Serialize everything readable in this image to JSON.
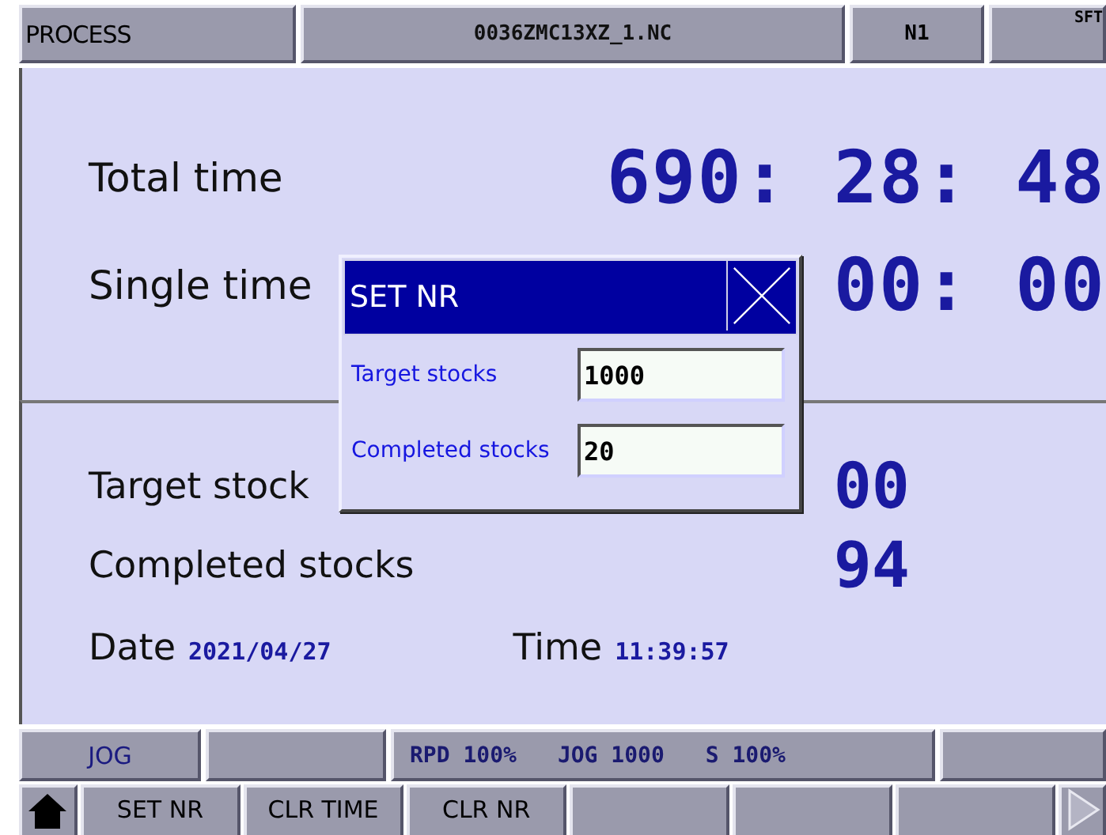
{
  "header": {
    "mode": "PROCESS",
    "program": "0036ZMC13XZ_1.NC",
    "sequence": "N1",
    "shift": "SFT"
  },
  "times": [
    {
      "label": "Total time",
      "value": "690: 28: 48"
    },
    {
      "label": "Single time",
      "value": "00: 00"
    }
  ],
  "stocks": [
    {
      "label": "Target stock",
      "value": "00"
    },
    {
      "label": "Completed stocks",
      "value": "94"
    }
  ],
  "date": {
    "label": "Date",
    "value": "2021/04/27"
  },
  "time": {
    "label": "Time",
    "value": "11:39:57"
  },
  "dialog": {
    "title": "SET NR",
    "fields": [
      {
        "label": "Target stocks",
        "value": "1000"
      },
      {
        "label": "Completed stocks",
        "value": "20"
      }
    ]
  },
  "status_bar": {
    "mode": "JOG",
    "overrides": [
      "RPD 100%",
      "JOG 1000",
      "S 100%"
    ]
  },
  "softkeys": [
    "SET NR",
    "CLR TIME",
    "CLR NR"
  ]
}
